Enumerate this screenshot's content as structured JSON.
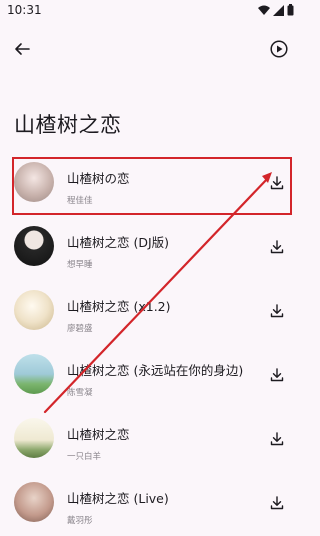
{
  "status_bar": {
    "time": "10:31"
  },
  "app_bar": {
    "back_icon": "arrow-left-icon",
    "play_icon": "play-circle-icon"
  },
  "page": {
    "title": "山楂树之恋"
  },
  "songs": [
    {
      "title": "山楂树の恋",
      "artist": "程佳佳",
      "avatar_color": "#d9c9c4"
    },
    {
      "title": "山楂树之恋 (DJ版)",
      "artist": "想早睡",
      "avatar_color": "#2b2b2b"
    },
    {
      "title": "山楂树之恋 (x1.2)",
      "artist": "廖碧盛",
      "avatar_color": "#efe6d0"
    },
    {
      "title": "山楂树之恋 (永远站在你的身边)",
      "artist": "陈雪凝",
      "avatar_color": "#9fc8d6"
    },
    {
      "title": "山楂树之恋",
      "artist": "一只白羊",
      "avatar_color": "#f3f0df"
    },
    {
      "title": "山楂树之恋 (Live)",
      "artist": "戴羽彤",
      "avatar_color": "#c6a89c"
    }
  ],
  "colors": {
    "background": "#fbf6fa",
    "annotation_red": "#d3252a"
  }
}
